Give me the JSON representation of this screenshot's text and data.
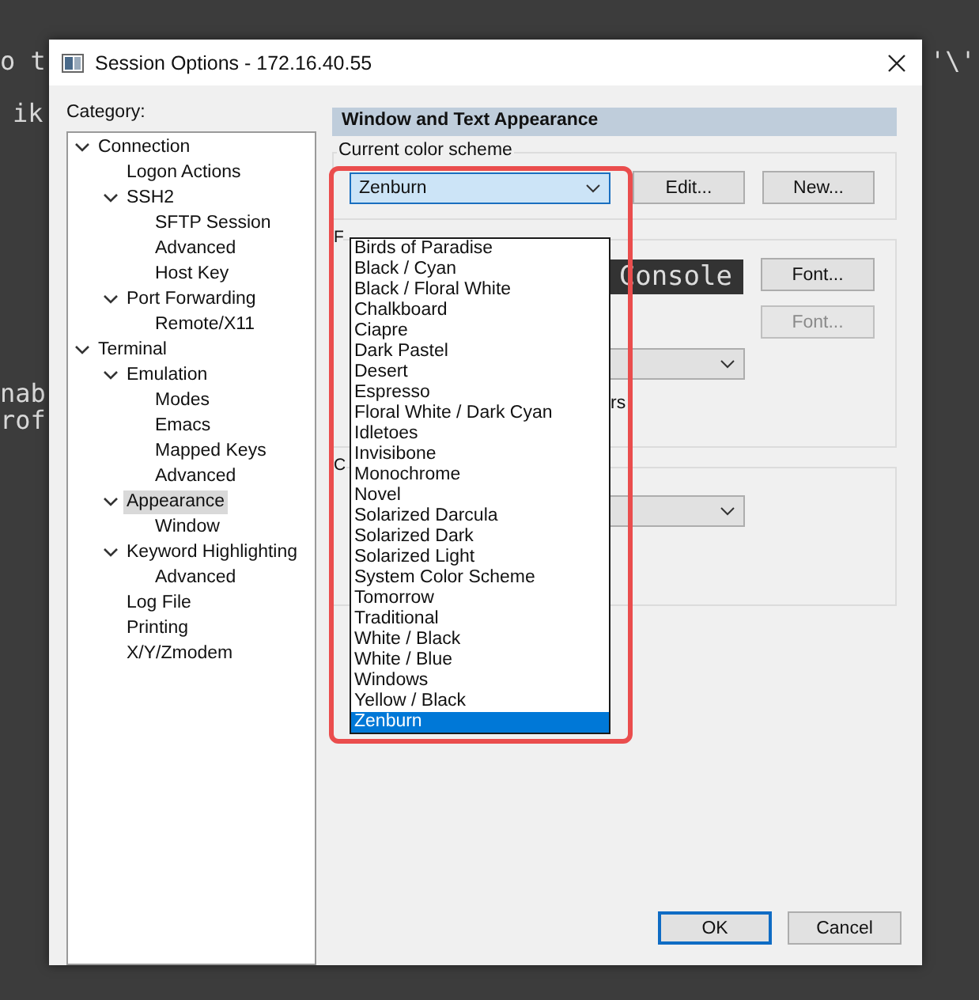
{
  "background_terminal": {
    "fragments": [
      "o t",
      "ik",
      "nab",
      "rof",
      "'\\'"
    ]
  },
  "window": {
    "title": "Session Options - 172.16.40.55"
  },
  "category": {
    "label": "Category:",
    "tree": [
      {
        "label": "Connection",
        "expanded": true,
        "selected": false,
        "children": [
          {
            "label": "Logon Actions",
            "selected": false
          },
          {
            "label": "SSH2",
            "expanded": true,
            "selected": false,
            "children": [
              {
                "label": "SFTP Session",
                "selected": false
              },
              {
                "label": "Advanced",
                "selected": false
              },
              {
                "label": "Host Key",
                "selected": false
              }
            ]
          },
          {
            "label": "Port Forwarding",
            "expanded": true,
            "selected": false,
            "children": [
              {
                "label": "Remote/X11",
                "selected": false
              }
            ]
          }
        ]
      },
      {
        "label": "Terminal",
        "expanded": true,
        "selected": false,
        "children": [
          {
            "label": "Emulation",
            "expanded": true,
            "selected": false,
            "children": [
              {
                "label": "Modes",
                "selected": false
              },
              {
                "label": "Emacs",
                "selected": false
              },
              {
                "label": "Mapped Keys",
                "selected": false
              },
              {
                "label": "Advanced",
                "selected": false
              }
            ]
          },
          {
            "label": "Appearance",
            "expanded": true,
            "selected": true,
            "children": [
              {
                "label": "Window",
                "selected": false
              }
            ]
          },
          {
            "label": "Keyword Highlighting",
            "expanded": true,
            "selected": false,
            "children": [
              {
                "label": "Advanced",
                "selected": false
              }
            ]
          },
          {
            "label": "Log File",
            "selected": false
          },
          {
            "label": "Printing",
            "selected": false
          },
          {
            "label": "X/Y/Zmodem",
            "selected": false
          }
        ]
      }
    ]
  },
  "panel": {
    "header": "Window and Text Appearance",
    "color_scheme": {
      "legend": "Current color scheme",
      "value": "Zenburn",
      "buttons": [
        {
          "label": "Edit...",
          "disabled": false
        },
        {
          "label": "New...",
          "disabled": false
        }
      ],
      "options": [
        {
          "label": "Birds of Paradise",
          "selected": false
        },
        {
          "label": "Black / Cyan",
          "selected": false
        },
        {
          "label": "Black / Floral White",
          "selected": false
        },
        {
          "label": "Chalkboard",
          "selected": false
        },
        {
          "label": "Ciapre",
          "selected": false
        },
        {
          "label": "Dark Pastel",
          "selected": false
        },
        {
          "label": "Desert",
          "selected": false
        },
        {
          "label": "Espresso",
          "selected": false
        },
        {
          "label": "Floral White / Dark Cyan",
          "selected": false
        },
        {
          "label": "Idletoes",
          "selected": false
        },
        {
          "label": "Invisibone",
          "selected": false
        },
        {
          "label": "Monochrome",
          "selected": false
        },
        {
          "label": "Novel",
          "selected": false
        },
        {
          "label": "Solarized Darcula",
          "selected": false
        },
        {
          "label": "Solarized Dark",
          "selected": false
        },
        {
          "label": "Solarized Light",
          "selected": false
        },
        {
          "label": "System Color Scheme",
          "selected": false
        },
        {
          "label": "Tomorrow",
          "selected": false
        },
        {
          "label": "Traditional",
          "selected": false
        },
        {
          "label": "White / Black",
          "selected": false
        },
        {
          "label": "White / Blue",
          "selected": false
        },
        {
          "label": "Windows",
          "selected": false
        },
        {
          "label": "Yellow / Black",
          "selected": false
        },
        {
          "label": "Zenburn",
          "selected": true
        }
      ]
    },
    "fonts": {
      "legend": "F",
      "preview": "Console",
      "buttons": [
        {
          "label": "Font...",
          "disabled": false
        },
        {
          "label": "Font...",
          "disabled": true
        }
      ],
      "checkbox_text_tail": "rs"
    },
    "cursor": {
      "legend": "C"
    }
  },
  "buttons": [
    {
      "label": "OK",
      "default": true
    },
    {
      "label": "Cancel",
      "default": false
    }
  ]
}
